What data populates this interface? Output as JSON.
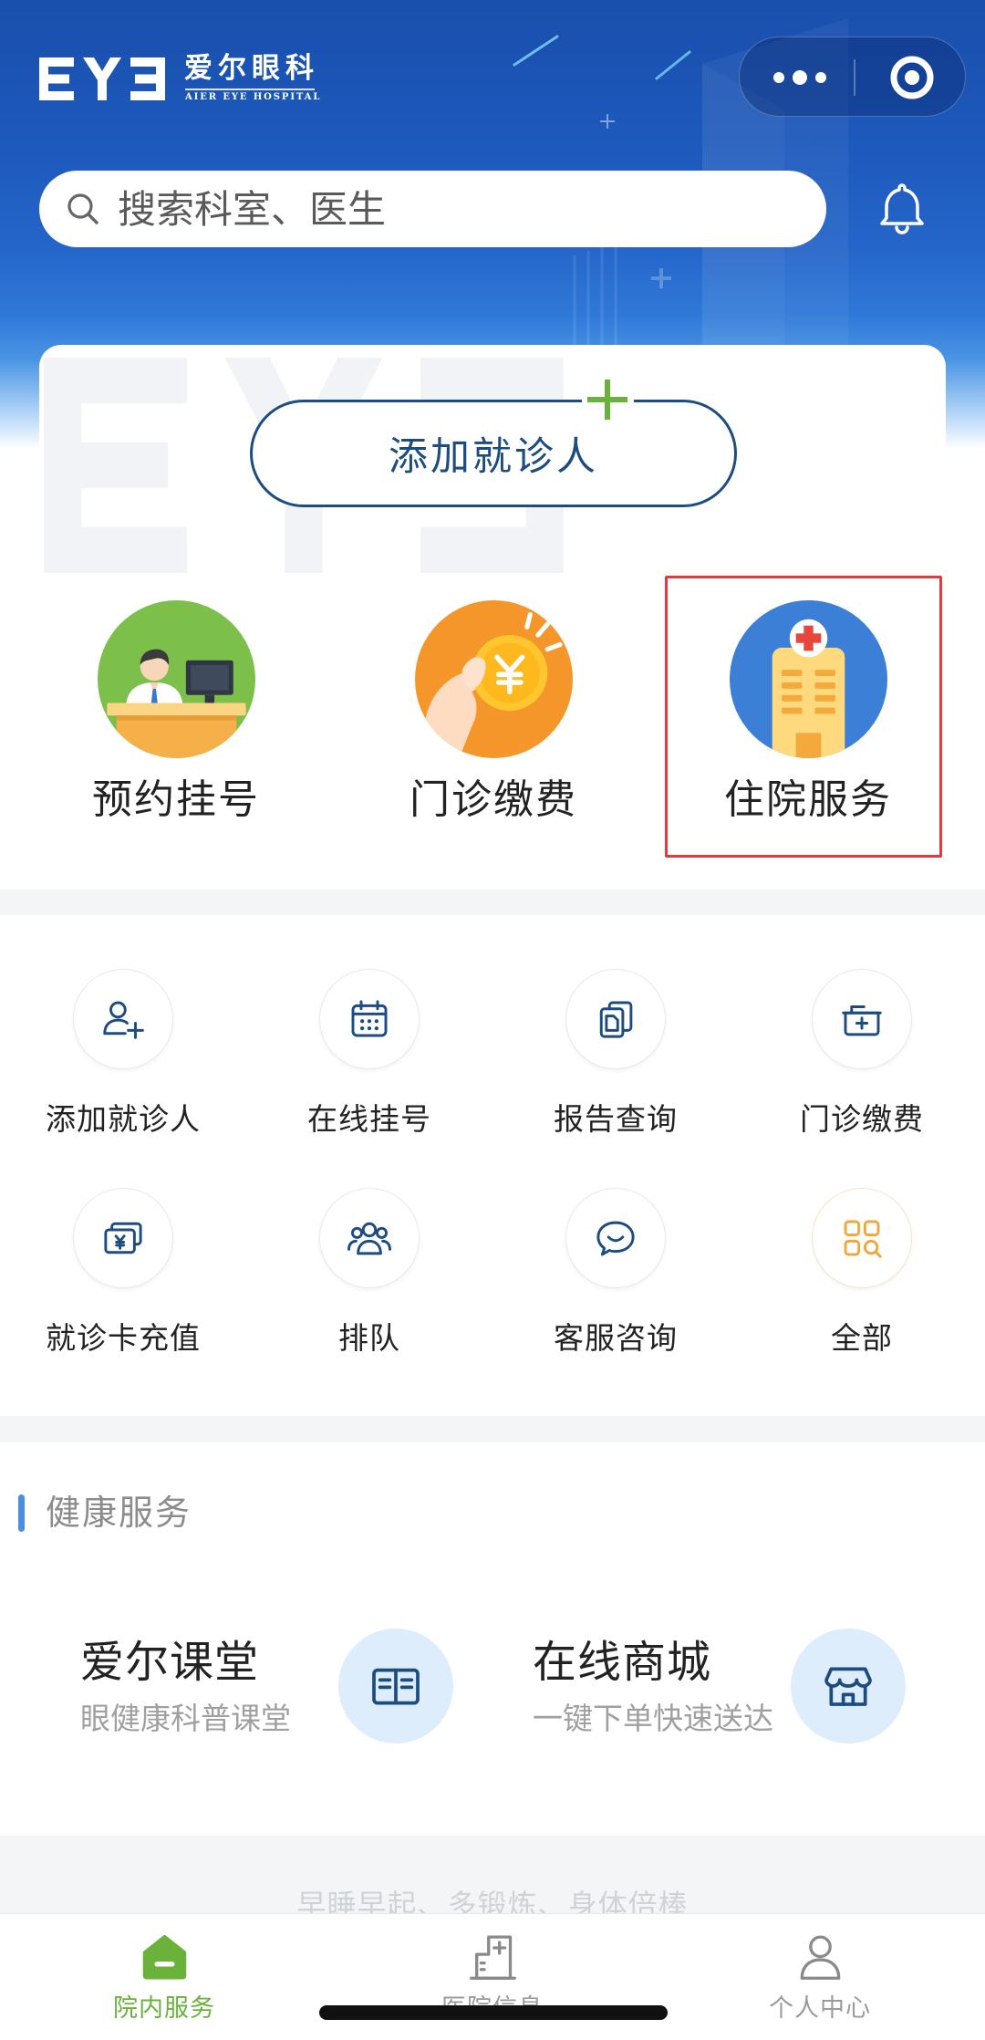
{
  "header": {
    "logo_mark": "EYE",
    "logo_name": "爱尔眼科",
    "logo_subtitle": "AIER EYE HOSPITAL",
    "capsule_icons": [
      "more-dots-icon",
      "target-circle-icon"
    ],
    "search": {
      "placeholder": "搜索科室、医生",
      "icon": "search-icon"
    },
    "notification_icon": "bell-icon"
  },
  "patient_card": {
    "add_patient_label": "添加就诊人",
    "add_icon": "plus-icon"
  },
  "featured": [
    {
      "label": "预约挂号",
      "icon": "doctor-desk-icon",
      "highlighted": false
    },
    {
      "label": "门诊缴费",
      "icon": "yuan-coin-hand-icon",
      "highlighted": false
    },
    {
      "label": "住院服务",
      "icon": "hospital-building-icon",
      "highlighted": true
    }
  ],
  "services": [
    {
      "label": "添加就诊人",
      "icon": "add-user-icon"
    },
    {
      "label": "在线挂号",
      "icon": "calendar-icon"
    },
    {
      "label": "报告查询",
      "icon": "documents-icon"
    },
    {
      "label": "门诊缴费",
      "icon": "medical-box-icon"
    },
    {
      "label": "就诊卡充值",
      "icon": "yuan-card-icon"
    },
    {
      "label": "排队",
      "icon": "queue-people-icon"
    },
    {
      "label": "客服咨询",
      "icon": "chat-bubble-icon"
    },
    {
      "label": "全部",
      "icon": "grid-search-icon"
    }
  ],
  "health": {
    "title": "健康服务",
    "items": [
      {
        "title": "爱尔课堂",
        "subtitle": "眼健康科普课堂",
        "icon": "open-book-icon"
      },
      {
        "title": "在线商城",
        "subtitle": "一键下单快速送达",
        "icon": "store-icon"
      }
    ]
  },
  "footer_tip": "早睡早起、多锻炼、身体倍棒",
  "tabbar": [
    {
      "label": "院内服务",
      "icon": "home-icon",
      "active": true
    },
    {
      "label": "医院信息",
      "icon": "hospital-info-icon",
      "active": false
    },
    {
      "label": "个人中心",
      "icon": "user-icon",
      "active": false
    }
  ],
  "colors": {
    "header_blue": "#1d58bb",
    "navy": "#1d4d80",
    "green": "#6ab23c",
    "highlight_red": "#e03a3e",
    "section_bar": "#4a90e2",
    "orange": "#f0a83a",
    "light_blue": "#ddedfb",
    "gray_band": "#f4f5f7"
  }
}
